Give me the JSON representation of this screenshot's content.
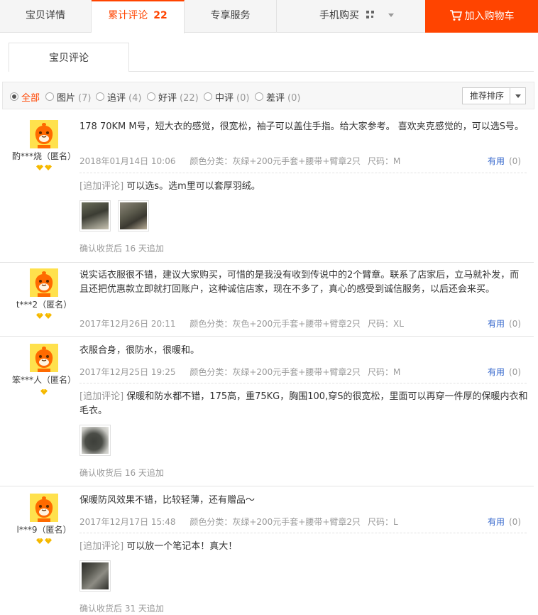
{
  "tabs": {
    "detail": "宝贝详情",
    "reviews": "累计评论",
    "reviews_count": "22",
    "service": "专享服务",
    "mobile": "手机购买",
    "cart": "加入购物车"
  },
  "subtab": "宝贝评论",
  "filters": [
    {
      "label": "全部",
      "count": "",
      "selected": true
    },
    {
      "label": "图片",
      "count": "(7)"
    },
    {
      "label": "追评",
      "count": "(4)"
    },
    {
      "label": "好评",
      "count": "(22)"
    },
    {
      "label": "中评",
      "count": "(0)"
    },
    {
      "label": "差评",
      "count": "(0)"
    }
  ],
  "sort_label": "推荐排序",
  "useful_label": "有用",
  "reviews": [
    {
      "user": "酌***烧（匿名）",
      "gems": 2,
      "text": "178 70KM M号，短大衣的感觉，很宽松，袖子可以盖住手指。给大家参考。 喜欢夹克感觉的，可以选S号。",
      "date": "2018年01月14日 10:06",
      "color": "颜色分类：灰绿+200元手套+腰带+臂章2只",
      "size": "尺码：M",
      "useful_count": "(0)",
      "append_tag": "[追加评论]",
      "append_text": "可以选s。选m里可以套厚羽绒。",
      "append_after": "确认收货后 16 天追加"
    },
    {
      "user": "t***2（匿名）",
      "gems": 2,
      "text": "说实话衣服很不错，建议大家购买，可惜的是我没有收到传说中的2个臂章。联系了店家后，立马就补发，而且还把优惠款立即就打回账户，这种诚信店家，现在不多了，真心的感受到诚信服务，以后还会来买。",
      "date": "2017年12月26日 20:11",
      "color": "颜色分类：灰色+200元手套+腰带+臂章2只",
      "size": "尺码：XL",
      "useful_count": "(0)"
    },
    {
      "user": "笨***人（匿名）",
      "gems": 1,
      "text": "衣服合身，很防水，很暖和。",
      "date": "2017年12月25日 19:25",
      "color": "颜色分类：灰绿+200元手套+腰带+臂章2只",
      "size": "尺码：M",
      "useful_count": "(0)",
      "append_tag": "[追加评论]",
      "append_text": "保暖和防水都不错，175高，重75KG，胸围100,穿S的很宽松，里面可以再穿一件厚的保暖内衣和毛衣。",
      "append_after": "确认收货后 16 天追加"
    },
    {
      "user": "l***9（匿名）",
      "gems": 2,
      "text": "保暖防风效果不错，比较轻薄，还有赠品～",
      "date": "2017年12月17日 15:48",
      "color": "颜色分类：灰绿+200元手套+腰带+臂章2只",
      "size": "尺码：L",
      "useful_count": "(0)",
      "append_tag": "[追加评论]",
      "append_text": "可以放一个笔记本！真大！",
      "append_after": "确认收货后 31 天追加"
    }
  ],
  "colors": {
    "accent": "#ff4400",
    "link": "#3366cc",
    "muted": "#999999"
  }
}
